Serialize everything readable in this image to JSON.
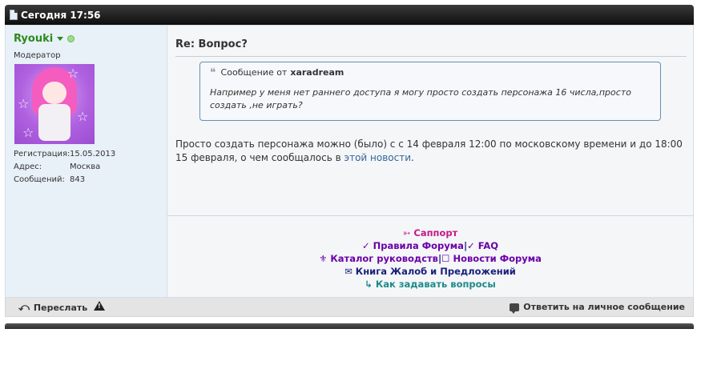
{
  "post": {
    "date": "Сегодня 17:56",
    "title": "Re: Вопрос?"
  },
  "user": {
    "name": "Ryouki",
    "title": "Модератор",
    "online": true,
    "stats": [
      {
        "label": "Регистрация:",
        "value": "15.05.2013"
      },
      {
        "label": "Адрес:",
        "value": "Москва"
      },
      {
        "label": "Сообщений:",
        "value": "843"
      }
    ]
  },
  "quote": {
    "prefix": "Сообщение от",
    "author": "xaradream",
    "text": "Например у меня нет раннего доступа я могу просто создать персонажа 16 числа,просто создать ,не играть?"
  },
  "message": {
    "text": "Просто создать персонажа можно (было) с с 14 февраля 12:00 по московскому времени и до 18:00 15 февраля, о чем сообщалось в ",
    "link": "этой новости",
    "end": "."
  },
  "signature": {
    "support": "➳ Саппорт",
    "rules": "✓ Правила Форума",
    "sep": "|",
    "faq": "✓ FAQ",
    "catalog": "⚜ Каталог руководств",
    "news": "☐ Новости Форума",
    "complaints": "✉ Книга Жалоб и Предложений",
    "howto": "↳ Как задавать вопросы"
  },
  "footer": {
    "forward": "Переслать",
    "reply_private": "Ответить на личное сообщение"
  },
  "colors": {
    "username": "#2a8a1c",
    "header": "#1a1a1a",
    "link": "#36659a"
  }
}
